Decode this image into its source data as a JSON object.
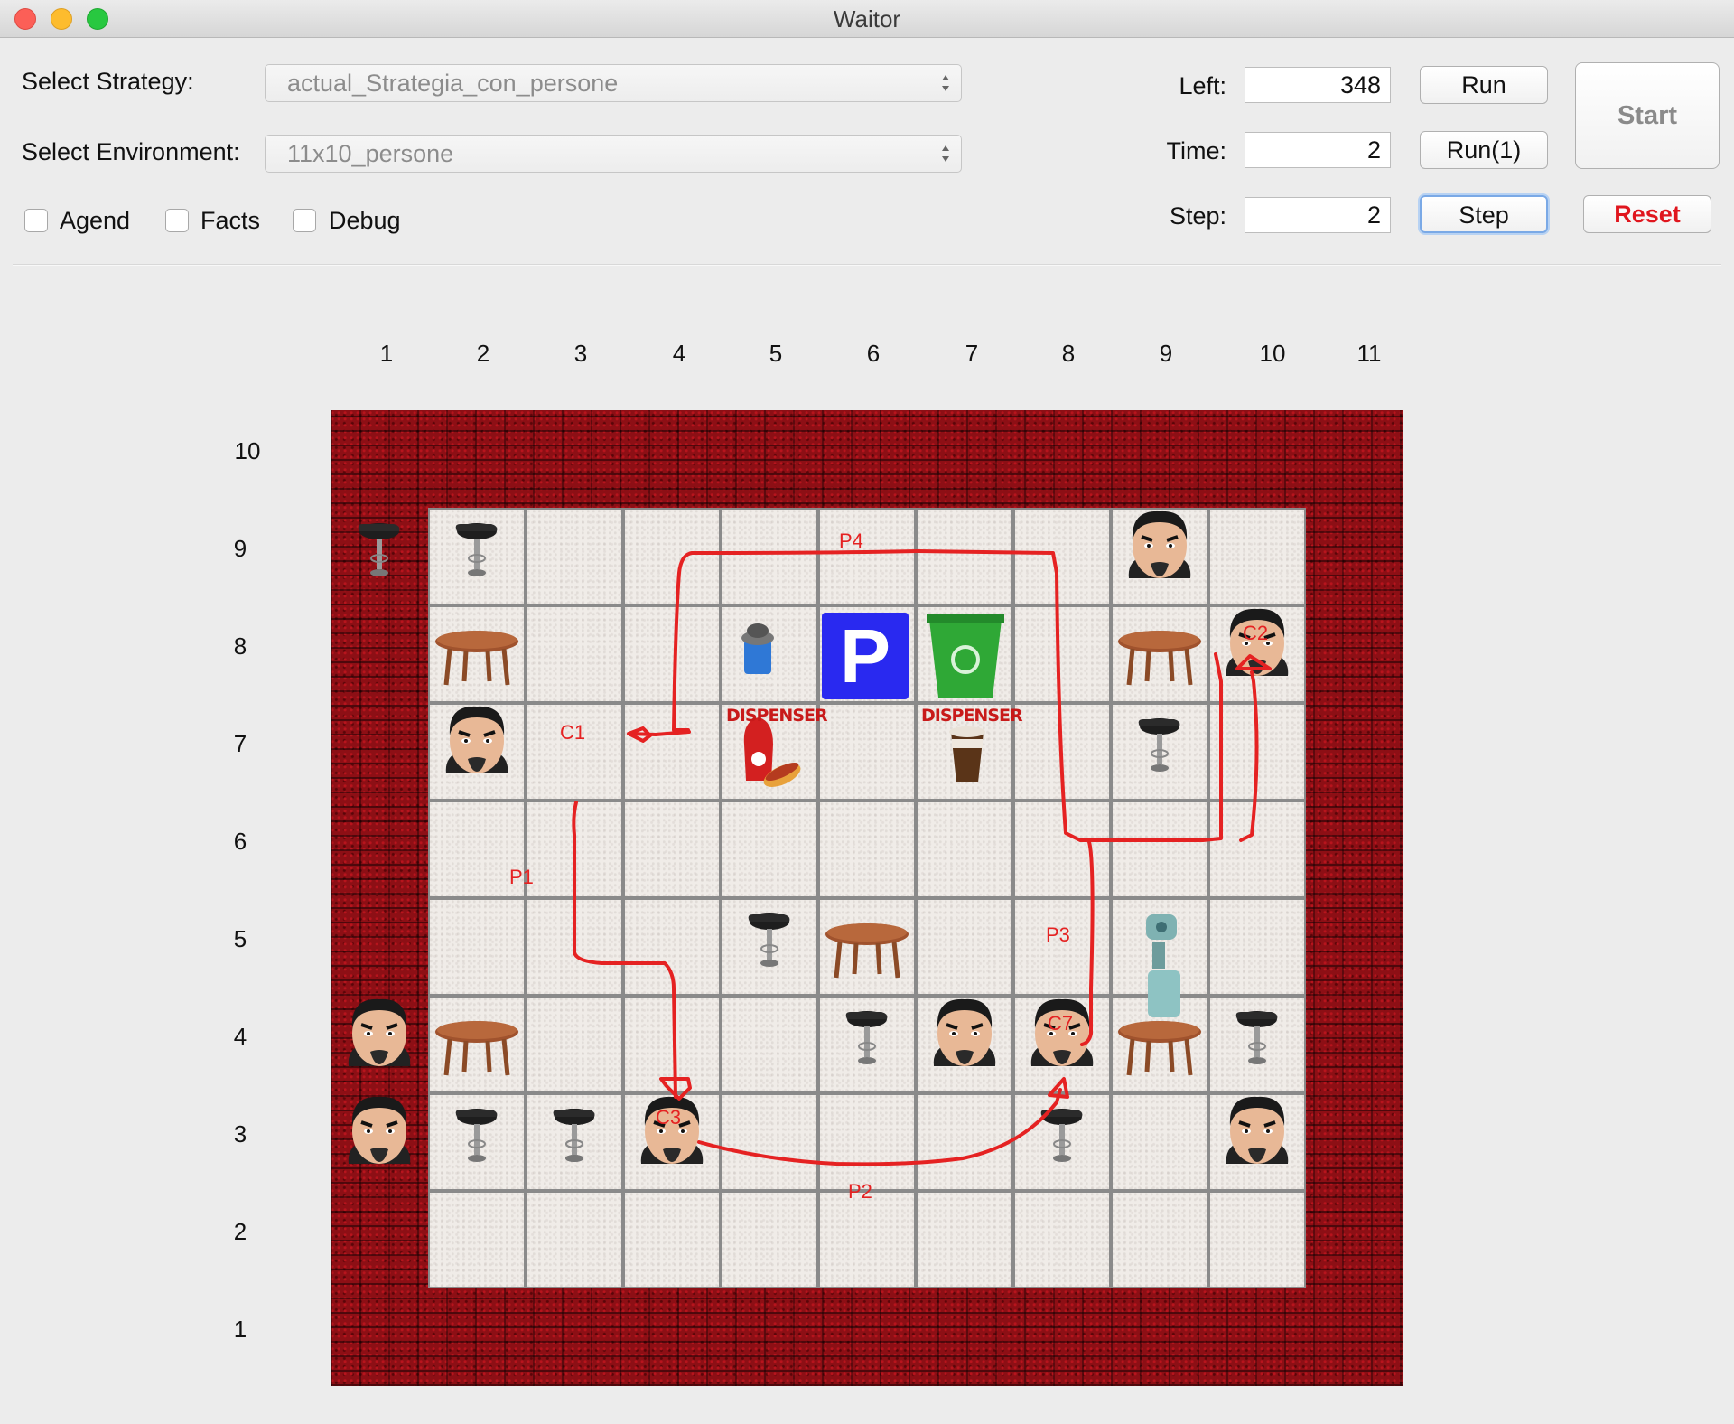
{
  "window": {
    "title": "Waitor"
  },
  "controls": {
    "strategy_label": "Select Strategy:",
    "strategy_value": "actual_Strategia_con_persone",
    "environment_label": "Select Environment:",
    "environment_value": "11x10_persone",
    "checkboxes": [
      {
        "label": "Agend",
        "checked": false
      },
      {
        "label": "Facts",
        "checked": false
      },
      {
        "label": "Debug",
        "checked": false
      }
    ],
    "left_label": "Left:",
    "left_value": "348",
    "time_label": "Time:",
    "time_value": "2",
    "step_label": "Step:",
    "step_value": "2",
    "run_label": "Run",
    "run1_label": "Run(1)",
    "step_button_label": "Step",
    "start_label": "Start",
    "reset_label": "Reset"
  },
  "grid": {
    "columns": [
      "1",
      "2",
      "3",
      "4",
      "5",
      "6",
      "7",
      "8",
      "9",
      "10",
      "11"
    ],
    "rows": [
      "10",
      "9",
      "8",
      "7",
      "6",
      "5",
      "4",
      "3",
      "2",
      "1"
    ],
    "dispenser_labels": [
      "DISPENSER",
      "DISPENSER"
    ],
    "parking_label": "P",
    "customer_labels": [
      "C1",
      "C2",
      "C3",
      "C7"
    ],
    "path_labels": [
      "P1",
      "P2",
      "P3",
      "P4"
    ]
  },
  "colors": {
    "path": "#e52222",
    "wall": "#8d0f15",
    "accent": "#e0161e"
  }
}
